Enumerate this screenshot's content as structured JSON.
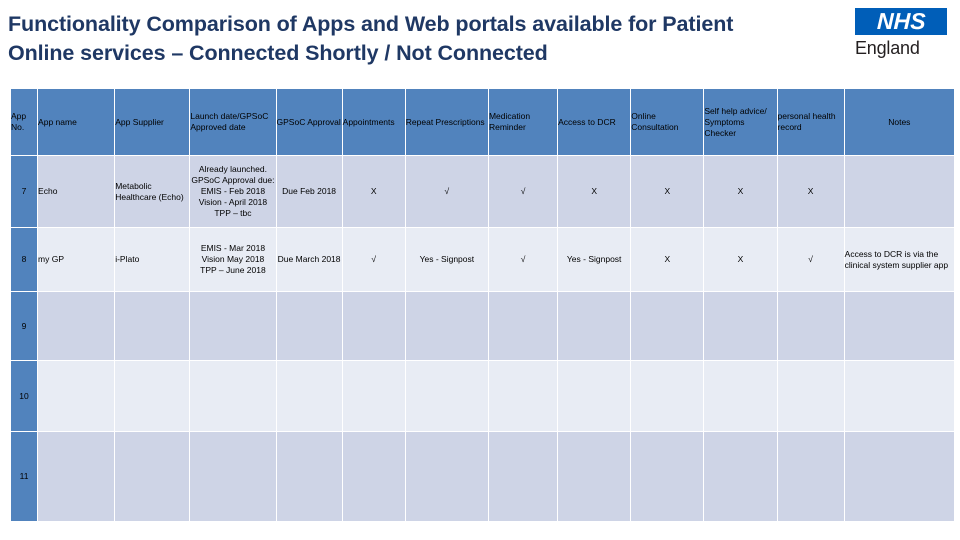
{
  "slide": {
    "title_line1": "Functionality Comparison of Apps and Web portals available for Patient",
    "title_line2": "Online services – Connected Shortly / Not Connected",
    "title_color": "#1f3864",
    "accent_color": "#5183bd",
    "band_dark_color": "#ced4e6",
    "band_light_color": "#e8ecf4"
  },
  "logo": {
    "name": "nhs-england-logo",
    "primary_text": "NHS",
    "secondary_text": "England",
    "box_color": "#005EB8"
  },
  "table": {
    "headers": [
      "App No.",
      "App name",
      "App Supplier",
      "Launch date/GPSoC Approved date",
      "GPSoC Approval",
      "Appointments",
      "Repeat Prescriptions",
      "Medication Reminder",
      "Access to DCR",
      "Online Consultation",
      "Self help advice/ Symptoms Checker",
      "personal health record",
      "Notes"
    ],
    "rows": [
      {
        "app_no": "7",
        "app_name": "Echo",
        "app_supplier": "Metabolic Healthcare (Echo)",
        "launch_date": "Already launched. GPSoC Approval due: EMIS - Feb 2018 Vision - April 2018 TPP – tbc",
        "launch_date_lines": [
          "Already launched.",
          "GPSoC Approval due:",
          "EMIS - Feb 2018",
          "Vision - April 2018",
          "TPP – tbc"
        ],
        "gpsoc_approval": "Due Feb 2018",
        "appointments": "X",
        "repeat_prescriptions": "√",
        "medication_reminder": "√",
        "access_to_dcr": "X",
        "online_consultation": "X",
        "self_help": "X",
        "personal_health_record": "X",
        "notes": ""
      },
      {
        "app_no": "8",
        "app_name": "my GP",
        "app_supplier": "i-Plato",
        "launch_date": "EMIS - Mar 2018 Vision May 2018 TPP – June 2018",
        "launch_date_lines": [
          "EMIS - Mar 2018",
          "Vision May 2018",
          "TPP – June 2018"
        ],
        "gpsoc_approval": "Due March 2018",
        "appointments": "√",
        "repeat_prescriptions": "Yes - Signpost",
        "medication_reminder": "√",
        "access_to_dcr": "Yes - Signpost",
        "online_consultation": "X",
        "self_help": "X",
        "personal_health_record": "√",
        "notes": "Access to DCR is via the clinical system supplier app"
      },
      {
        "app_no": "9",
        "app_name": "",
        "app_supplier": "",
        "launch_date": "",
        "launch_date_lines": [],
        "gpsoc_approval": "",
        "appointments": "",
        "repeat_prescriptions": "",
        "medication_reminder": "",
        "access_to_dcr": "",
        "online_consultation": "",
        "self_help": "",
        "personal_health_record": "",
        "notes": ""
      },
      {
        "app_no": "10",
        "app_name": "",
        "app_supplier": "",
        "launch_date": "",
        "launch_date_lines": [],
        "gpsoc_approval": "",
        "appointments": "",
        "repeat_prescriptions": "",
        "medication_reminder": "",
        "access_to_dcr": "",
        "online_consultation": "",
        "self_help": "",
        "personal_health_record": "",
        "notes": ""
      },
      {
        "app_no": "11",
        "app_name": "",
        "app_supplier": "",
        "launch_date": "",
        "launch_date_lines": [],
        "gpsoc_approval": "",
        "appointments": "",
        "repeat_prescriptions": "",
        "medication_reminder": "",
        "access_to_dcr": "",
        "online_consultation": "",
        "self_help": "",
        "personal_health_record": "",
        "notes": ""
      }
    ]
  }
}
